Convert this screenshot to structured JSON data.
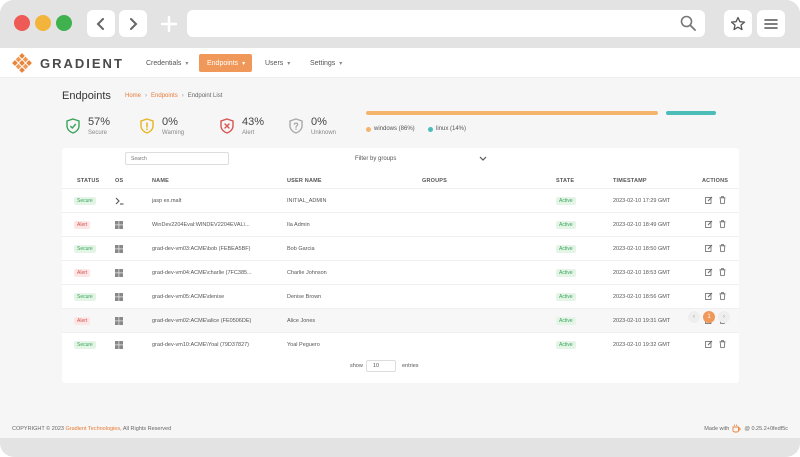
{
  "brand": {
    "name": "GRADIENT"
  },
  "nav": {
    "items": [
      {
        "label": "Credentials"
      },
      {
        "label": "Endpoints"
      },
      {
        "label": "Users"
      },
      {
        "label": "Settings"
      }
    ]
  },
  "header": {
    "title": "Endpoints",
    "breadcrumb": [
      "Home",
      "Endpoints",
      "Endpoint List"
    ]
  },
  "stats": [
    {
      "value": "57%",
      "label": "Secure",
      "color": "#3aa35a"
    },
    {
      "value": "0%",
      "label": "Warning",
      "color": "#e6b422"
    },
    {
      "value": "43%",
      "label": "Alert",
      "color": "#d9534f"
    },
    {
      "value": "0%",
      "label": "Unknown",
      "color": "#aaaaaa"
    }
  ],
  "os_distribution": [
    {
      "label": "windows (86%)",
      "share": 0.86,
      "color": "#f5b36e"
    },
    {
      "label": "linux (14%)",
      "share": 0.14,
      "color": "#4cbcb8"
    }
  ],
  "table": {
    "search_placeholder": "Search",
    "filter_label": "Filter by groups",
    "columns": [
      "STATUS",
      "OS",
      "NAME",
      "USER NAME",
      "GROUPS",
      "STATE",
      "TIMESTAMP",
      "ACTIONS"
    ],
    "rows": [
      {
        "status": "Secure",
        "os": "linux",
        "name": "jasp ex.malt",
        "user": "INITIAL_ADMIN",
        "groups": "",
        "state": "Active",
        "timestamp": "2023-02-10 17:29 GMT"
      },
      {
        "status": "Alert",
        "os": "windows",
        "name": "WinDev2204Eval:WINDEV2204EVAL\\...",
        "user": "Ila Admin",
        "groups": "",
        "state": "Active",
        "timestamp": "2023-02-10 18:49 GMT"
      },
      {
        "status": "Secure",
        "os": "windows",
        "name": "grad-dev-vm03:ACME\\bob (FEBEA5BF)",
        "user": "Bob Garcia",
        "groups": "",
        "state": "Active",
        "timestamp": "2023-02-10 18:50 GMT"
      },
      {
        "status": "Alert",
        "os": "windows",
        "name": "grad-dev-vm04:ACME\\charlie (7FC385...",
        "user": "Charlie Johnson",
        "groups": "",
        "state": "Active",
        "timestamp": "2023-02-10 18:53 GMT"
      },
      {
        "status": "Secure",
        "os": "windows",
        "name": "grad-dev-vm05:ACME\\denise",
        "user": "Denise Brown",
        "groups": "",
        "state": "Active",
        "timestamp": "2023-02-10 18:56 GMT"
      },
      {
        "status": "Alert",
        "os": "windows",
        "name": "grad-dev-vm02:ACME\\alice (FE0506DE)",
        "user": "Alice Jones",
        "groups": "",
        "state": "Active",
        "timestamp": "2023-02-10 19:31 GMT"
      },
      {
        "status": "Secure",
        "os": "windows",
        "name": "grad-dev-vm10:ACME\\Yoal (79D37827)",
        "user": "Yoal Peguero",
        "groups": "",
        "state": "Active",
        "timestamp": "2023-02-10 19:32 GMT"
      }
    ],
    "show_label": "show",
    "page_size": "10",
    "entries_label": "entries",
    "pagination": {
      "prev": "‹",
      "current": "1",
      "next": "›"
    }
  },
  "footer": {
    "copyright_prefix": "COPYRIGHT © 2023 ",
    "copyright_brand": "Gradient Technologies",
    "copyright_suffix": ", All Rights Reserved",
    "made_with": "Made with",
    "version": "@ 0.25.2+0fedf5c"
  }
}
